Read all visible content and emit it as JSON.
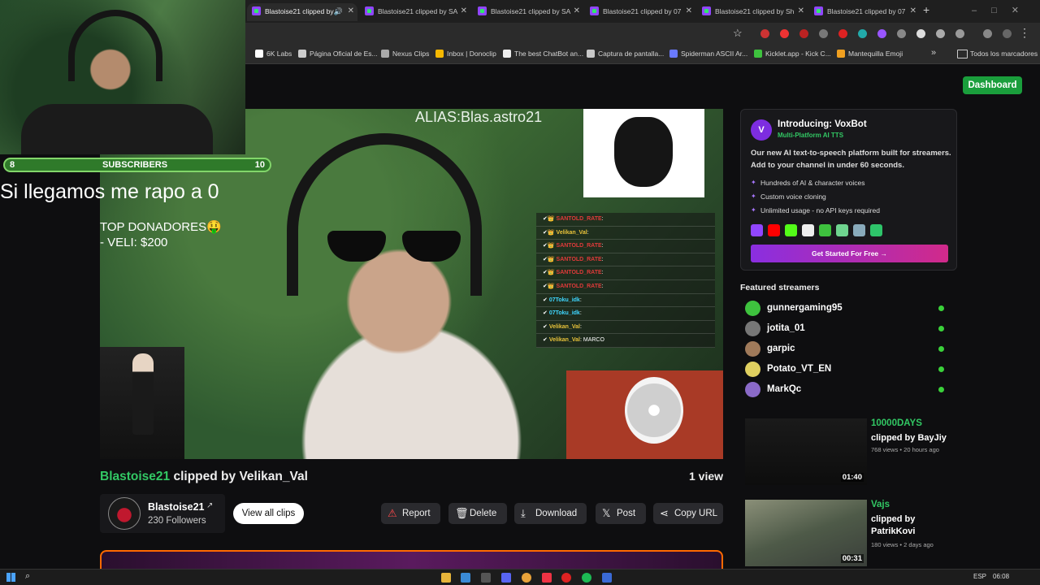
{
  "browser": {
    "tabs": [
      {
        "label": "Blastoise21 clipped by",
        "active": true
      },
      {
        "label": "Blastoise21 clipped by SA"
      },
      {
        "label": "Blastoise21 clipped by SA"
      },
      {
        "label": "Blastoise21 clipped by 07"
      },
      {
        "label": "Blastoise21 clipped by Sh"
      },
      {
        "label": "Blastoise21 clipped by 07"
      }
    ],
    "new_tab": "+",
    "bookmarks": [
      "6K Labs",
      "Página Oficial de Es...",
      "Nexus Clips",
      "Inbox | Donoclip",
      "The best ChatBot an...",
      "Captura de pantalla...",
      "Spiderman ASCII Ar...",
      "Kicklet.app - Kick C...",
      "Mantequilla Emoji"
    ],
    "bookmarks_all": "Todos los marcadores"
  },
  "header": {
    "dashboard_label": "Dashboard"
  },
  "overlay": {
    "subs_current": "8",
    "subs_label": "SUBSCRIBERS",
    "subs_goal": "10",
    "goal_text": "Si llegamos me rapo a 0",
    "donors_title": "TOP DONADORES🤑",
    "donors_line": "- VELI: $200",
    "alias": "ALIAS:Blas.astro21"
  },
  "chat": [
    {
      "name": "SANTOLD_RATE",
      "color": "#e03a3a",
      "msg": ""
    },
    {
      "name": "Velikan_Val",
      "color": "#e8c23a",
      "msg": ""
    },
    {
      "name": "SANTOLD_RATE",
      "color": "#e03a3a",
      "msg": ""
    },
    {
      "name": "SANTOLD_RATE",
      "color": "#e03a3a",
      "msg": ""
    },
    {
      "name": "SANTOLD_RATE",
      "color": "#e03a3a",
      "msg": ""
    },
    {
      "name": "SANTOLD_RATE",
      "color": "#e03a3a",
      "msg": ""
    },
    {
      "name": "07Toku_idk",
      "color": "#3fd6ff",
      "msg": ""
    },
    {
      "name": "07Toku_idk",
      "color": "#3fd6ff",
      "msg": ""
    },
    {
      "name": "Velikan_Val",
      "color": "#e8c23a",
      "msg": ""
    },
    {
      "name": "Velikan_Val",
      "color": "#e8c23a",
      "msg": "MARCO"
    }
  ],
  "clip": {
    "channel": "Blastoise21",
    "title_rest": "clipped by Velikan_Val",
    "views": "1 view"
  },
  "channel_card": {
    "name": "Blastoise21",
    "followers": "230 Followers",
    "view_all": "View all clips"
  },
  "actions": {
    "report": "Report",
    "delete": "Delete",
    "download": "Download",
    "post": "Post",
    "copy_url": "Copy URL"
  },
  "ad": {
    "logo": "V",
    "title": "Introducing: VoxBot",
    "subtitle": "Multi-Platform AI TTS",
    "description": "Our new AI text-to-speech platform built for streamers. Add to your channel in under 60 seconds.",
    "features": [
      "Hundreds of AI & character voices",
      "Custom voice cloning",
      "Unlimited usage - no API keys required"
    ],
    "cta": "Get Started For Free →"
  },
  "featured": {
    "heading": "Featured streamers",
    "streamers": [
      {
        "name": "gunnergaming95",
        "color": "#3ec23e"
      },
      {
        "name": "jotita_01",
        "color": "#777"
      },
      {
        "name": "garpic",
        "color": "#a07a5a"
      },
      {
        "name": "Potato_VT_EN",
        "color": "#e0d060"
      },
      {
        "name": "MarkQc",
        "color": "#8a6ac8"
      }
    ]
  },
  "related": [
    {
      "title": "10000DAYS",
      "by": "clipped by BayJiy",
      "meta": "768 views • 20 hours ago",
      "duration": "01:40"
    },
    {
      "title": "Vajs",
      "by": "clipped by PatrikKovi",
      "meta": "180 views • 2 days ago",
      "duration": "00:31"
    }
  ],
  "taskbar": {
    "lang": "ESP",
    "time": "06:08"
  }
}
